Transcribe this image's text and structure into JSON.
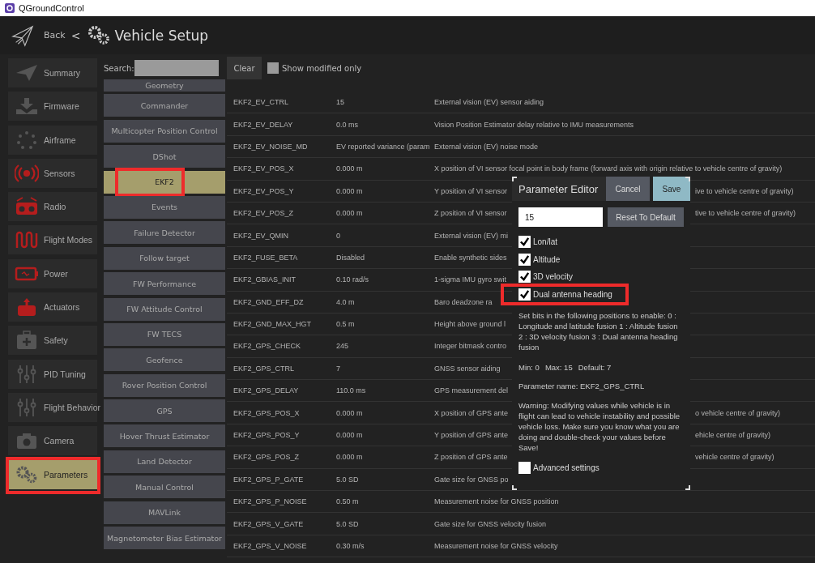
{
  "window": {
    "title": "QGroundControl"
  },
  "header": {
    "back_label": "Back",
    "separator": "<",
    "title": "Vehicle Setup"
  },
  "sidebar": {
    "items": [
      {
        "label": "Summary",
        "kind": "plane",
        "needs_setup": false,
        "selected": false,
        "highlighted": false
      },
      {
        "label": "Firmware",
        "kind": "download",
        "needs_setup": false,
        "selected": false,
        "highlighted": false
      },
      {
        "label": "Airframe",
        "kind": "dots",
        "needs_setup": false,
        "selected": false,
        "highlighted": false
      },
      {
        "label": "Sensors",
        "kind": "signal",
        "needs_setup": true,
        "selected": false,
        "highlighted": false
      },
      {
        "label": "Radio",
        "kind": "radio",
        "needs_setup": true,
        "selected": false,
        "highlighted": false
      },
      {
        "label": "Flight Modes",
        "kind": "wave",
        "needs_setup": true,
        "selected": false,
        "highlighted": false
      },
      {
        "label": "Power",
        "kind": "battery",
        "needs_setup": true,
        "selected": false,
        "highlighted": false
      },
      {
        "label": "Actuators",
        "kind": "actuator",
        "needs_setup": true,
        "selected": false,
        "highlighted": false
      },
      {
        "label": "Safety",
        "kind": "kit",
        "needs_setup": false,
        "selected": false,
        "highlighted": false
      },
      {
        "label": "PID Tuning",
        "kind": "sliders",
        "needs_setup": false,
        "selected": false,
        "highlighted": false
      },
      {
        "label": "Flight Behavior",
        "kind": "sliders",
        "needs_setup": false,
        "selected": false,
        "highlighted": false
      },
      {
        "label": "Camera",
        "kind": "camera",
        "needs_setup": false,
        "selected": false,
        "highlighted": false
      },
      {
        "label": "Parameters",
        "kind": "gears",
        "needs_setup": false,
        "selected": true,
        "highlighted": true
      }
    ]
  },
  "toolbar": {
    "search_label": "Search:",
    "clear_label": "Clear",
    "show_modified": {
      "label": "Show modified only",
      "checked": false
    }
  },
  "groups": [
    {
      "label": "Geometry",
      "selected": false,
      "highlighted": false
    },
    {
      "label": "Commander",
      "selected": false,
      "highlighted": false
    },
    {
      "label": "Multicopter Position Control",
      "selected": false,
      "highlighted": false
    },
    {
      "label": "DShot",
      "selected": false,
      "highlighted": false
    },
    {
      "label": "EKF2",
      "selected": true,
      "highlighted": true
    },
    {
      "label": "Events",
      "selected": false,
      "highlighted": false
    },
    {
      "label": "Failure Detector",
      "selected": false,
      "highlighted": false
    },
    {
      "label": "Follow target",
      "selected": false,
      "highlighted": false
    },
    {
      "label": "FW Performance",
      "selected": false,
      "highlighted": false
    },
    {
      "label": "FW Attitude Control",
      "selected": false,
      "highlighted": false
    },
    {
      "label": "FW TECS",
      "selected": false,
      "highlighted": false
    },
    {
      "label": "Geofence",
      "selected": false,
      "highlighted": false
    },
    {
      "label": "Rover Position Control",
      "selected": false,
      "highlighted": false
    },
    {
      "label": "GPS",
      "selected": false,
      "highlighted": false
    },
    {
      "label": "Hover Thrust Estimator",
      "selected": false,
      "highlighted": false
    },
    {
      "label": "Land Detector",
      "selected": false,
      "highlighted": false
    },
    {
      "label": "Manual Control",
      "selected": false,
      "highlighted": false
    },
    {
      "label": "MAVLink",
      "selected": false,
      "highlighted": false
    },
    {
      "label": "Magnetometer Bias Estimator",
      "selected": false,
      "highlighted": false
    }
  ],
  "table": {
    "rows": [
      {
        "name": "EKF2_EV_CTRL",
        "value": "15",
        "description": "External vision (EV) sensor aiding"
      },
      {
        "name": "EKF2_EV_DELAY",
        "value": "0.0 ms",
        "description": "Vision Position Estimator delay relative to IMU measurements"
      },
      {
        "name": "EKF2_EV_NOISE_MD",
        "value": "EV reported variance (param",
        "description": "External vision (EV) noise mode"
      },
      {
        "name": "EKF2_EV_POS_X",
        "value": "0.000 m",
        "description": "X position of VI sensor focal point in body frame (forward axis with origin relative to vehicle centre of gravity)"
      },
      {
        "name": "EKF2_EV_POS_Y",
        "value": "0.000 m",
        "description": "Y position of VI sensor",
        "description_right": "ive to vehicle centre of gravity)"
      },
      {
        "name": "EKF2_EV_POS_Z",
        "value": "0.000 m",
        "description": "Z position of VI sensor",
        "description_right": "tive to vehicle centre of gravity)"
      },
      {
        "name": "EKF2_EV_QMIN",
        "value": "0",
        "description": "External vision (EV) mi",
        "description_right": ""
      },
      {
        "name": "EKF2_FUSE_BETA",
        "value": "Disabled",
        "description": "Enable synthetic sides",
        "description_right": ""
      },
      {
        "name": "EKF2_GBIAS_INIT",
        "value": "0.10 rad/s",
        "description": "1-sigma IMU gyro swit",
        "description_right": ""
      },
      {
        "name": "EKF2_GND_EFF_DZ",
        "value": "4.0 m",
        "description": "Baro deadzone ra",
        "description_right": ""
      },
      {
        "name": "EKF2_GND_MAX_HGT",
        "value": "0.5 m",
        "description": "Height above ground l",
        "description_right": ""
      },
      {
        "name": "EKF2_GPS_CHECK",
        "value": "245",
        "description": "Integer bitmask contro",
        "description_right": ""
      },
      {
        "name": "EKF2_GPS_CTRL",
        "value": "7",
        "description": "GNSS sensor aiding",
        "description_right": ""
      },
      {
        "name": "EKF2_GPS_DELAY",
        "value": "110.0 ms",
        "description": "GPS measurement del",
        "description_right": ""
      },
      {
        "name": "EKF2_GPS_POS_X",
        "value": "0.000 m",
        "description": "X position of GPS ante",
        "description_right": "o vehicle centre of gravity)"
      },
      {
        "name": "EKF2_GPS_POS_Y",
        "value": "0.000 m",
        "description": "Y position of GPS ante",
        "description_right": "ehicle centre of gravity)"
      },
      {
        "name": "EKF2_GPS_POS_Z",
        "value": "0.000 m",
        "description": "Z position of GPS ante",
        "description_right": "vehicle centre of gravity)"
      },
      {
        "name": "EKF2_GPS_P_GATE",
        "value": "5.0 SD",
        "description": "Gate size for GNSS po",
        "description_right": ""
      },
      {
        "name": "EKF2_GPS_P_NOISE",
        "value": "0.50 m",
        "description": "Measurement noise for GNSS position"
      },
      {
        "name": "EKF2_GPS_V_GATE",
        "value": "5.0 SD",
        "description": "Gate size for GNSS velocity fusion"
      },
      {
        "name": "EKF2_GPS_V_NOISE",
        "value": "0.30 m/s",
        "description": "Measurement noise for GNSS velocity"
      }
    ]
  },
  "dialog": {
    "title": "Parameter Editor",
    "cancel_label": "Cancel",
    "save_label": "Save",
    "value": "15",
    "reset_label": "Reset To Default",
    "options": [
      {
        "label": "Lon/lat",
        "checked": true,
        "highlighted": false
      },
      {
        "label": "Altitude",
        "checked": true,
        "highlighted": false
      },
      {
        "label": "3D velocity",
        "checked": true,
        "highlighted": false
      },
      {
        "label": "Dual antenna heading",
        "checked": true,
        "highlighted": true
      }
    ],
    "description": "Set bits in the following positions to enable: 0 : Longitude and latitude fusion 1 : Altitude fusion 2 : 3D velocity fusion 3 : Dual antenna heading fusion",
    "min": "Min: 0",
    "max": "Max: 15",
    "default": "Default: 7",
    "parameter_name": "Parameter name: EKF2_GPS_CTRL",
    "warning": "Warning: Modifying values while vehicle is in flight can lead to vehicle instability and possible vehicle loss. Make sure you know what you are doing and double-check your values before Save!",
    "advanced": {
      "label": "Advanced settings",
      "checked": false
    }
  }
}
